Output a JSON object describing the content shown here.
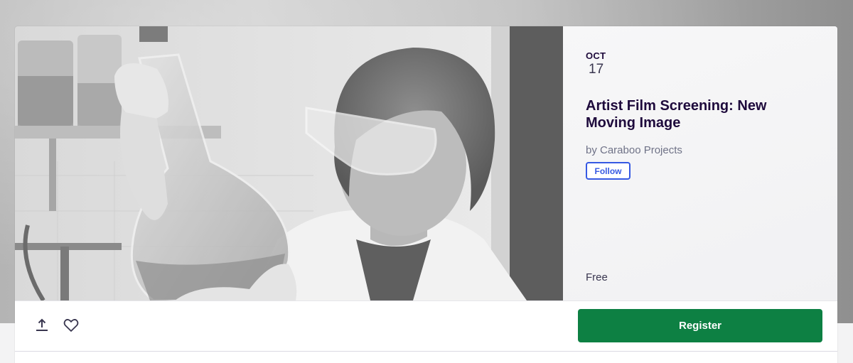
{
  "event": {
    "date_month": "OCT",
    "date_day": "17",
    "title": "Artist Film Screening: New Moving Image",
    "organizer": "by Caraboo Projects",
    "follow_label": "Follow",
    "price": "Free"
  },
  "hero_image": {
    "description_icon": "photo-scientist-holding-flask",
    "style": "grayscale"
  },
  "actions": {
    "share_icon": "share-icon",
    "like_icon": "heart-icon",
    "register_label": "Register"
  },
  "colors": {
    "register_bg": "#0d8043",
    "follow_accent": "#3659e3",
    "title_text": "#1e0a3c"
  }
}
